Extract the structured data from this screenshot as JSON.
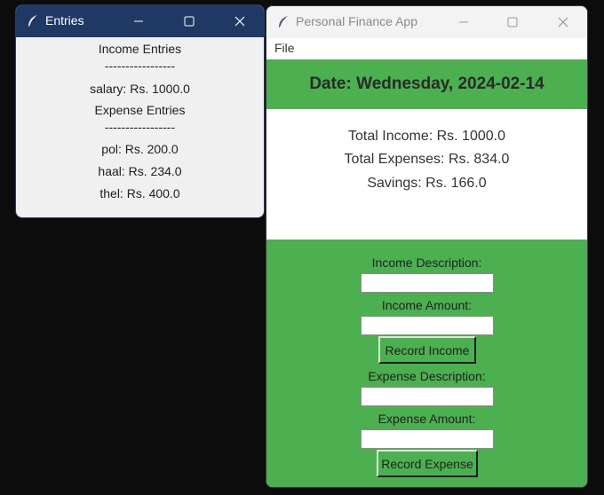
{
  "entries_window": {
    "title": "Entries",
    "income_header": "Income Entries",
    "divider": "-----------------",
    "income_items": [
      "salary: Rs. 1000.0"
    ],
    "expense_header": "Expense Entries",
    "expense_items": [
      "pol: Rs. 200.0",
      "haal: Rs. 234.0",
      "thel: Rs. 400.0"
    ]
  },
  "finance_window": {
    "title": "Personal Finance App",
    "menu": {
      "file": "File"
    },
    "date_label": "Date: Wednesday, 2024-02-14",
    "summary": {
      "total_income": "Total Income: Rs. 1000.0",
      "total_expenses": "Total Expenses: Rs. 834.0",
      "savings": "Savings: Rs. 166.0"
    },
    "form": {
      "income_description_label": "Income Description:",
      "income_description_value": "",
      "income_amount_label": "Income Amount:",
      "income_amount_value": "",
      "record_income_button": "Record Income",
      "expense_description_label": "Expense Description:",
      "expense_description_value": "",
      "expense_amount_label": "Expense Amount:",
      "expense_amount_value": "",
      "record_expense_button": "Record Expense"
    }
  },
  "window_controls": {
    "minimize": "—",
    "maximize": "☐",
    "close": "✕"
  },
  "colors": {
    "accent_green": "#4caf50",
    "entries_titlebar": "#1f3864",
    "background": "#0c0c0c"
  }
}
